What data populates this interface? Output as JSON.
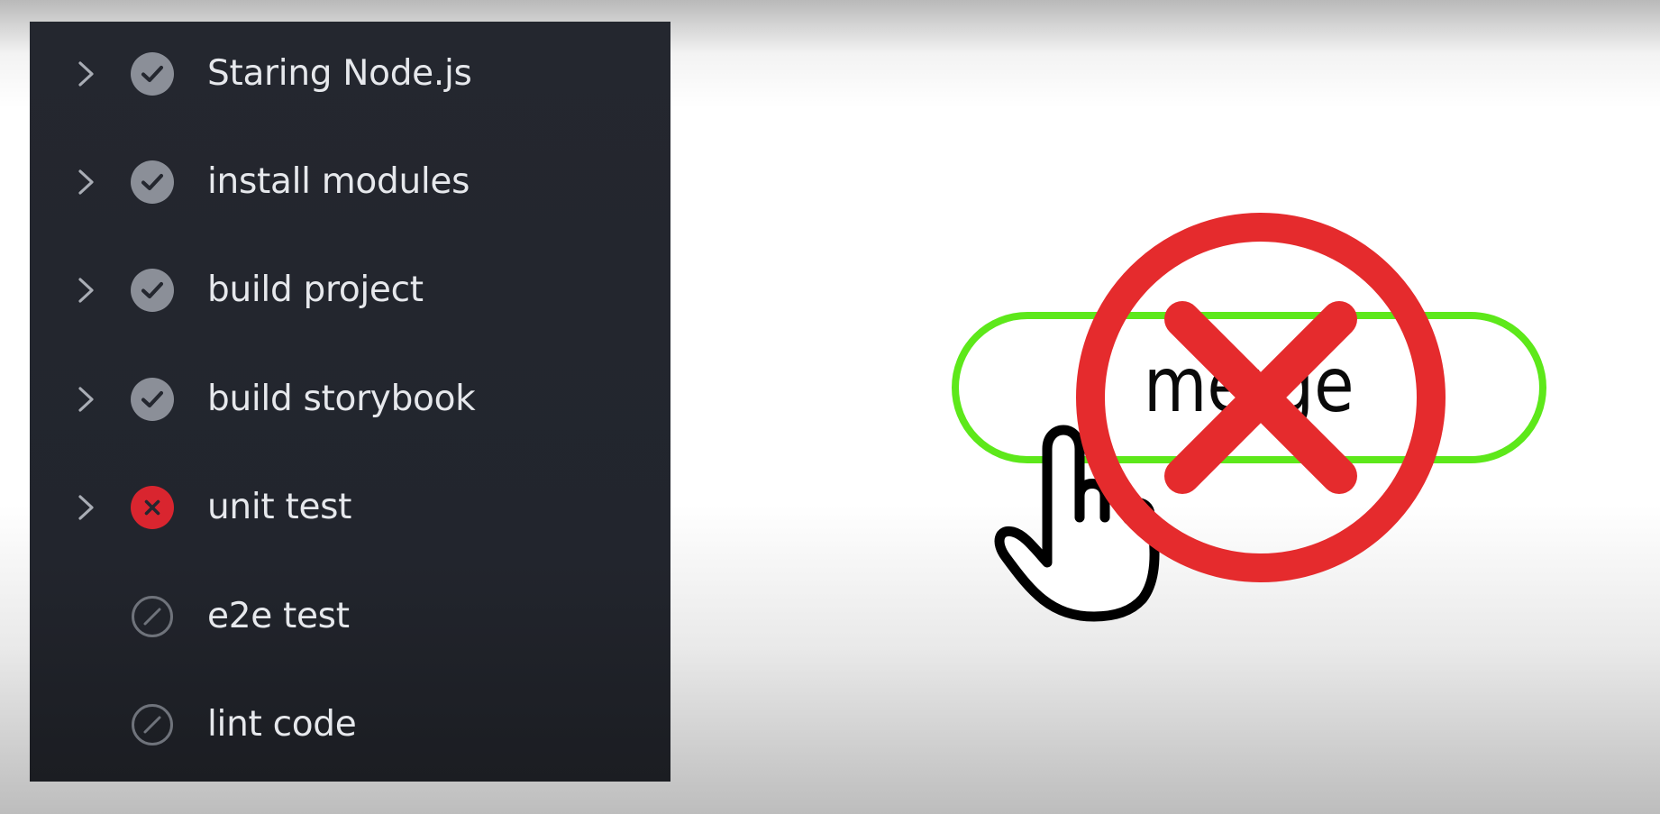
{
  "pipeline": {
    "steps": [
      {
        "label": "Staring Node.js",
        "status": "success",
        "expandable": true
      },
      {
        "label": "install modules",
        "status": "success",
        "expandable": true
      },
      {
        "label": "build project",
        "status": "success",
        "expandable": true
      },
      {
        "label": "build storybook",
        "status": "success",
        "expandable": true
      },
      {
        "label": "unit test",
        "status": "failed",
        "expandable": true
      },
      {
        "label": "e2e test",
        "status": "skipped",
        "expandable": false
      },
      {
        "label": "lint code",
        "status": "skipped",
        "expandable": false
      }
    ]
  },
  "merge": {
    "button_label": "merge",
    "blocked": true
  },
  "colors": {
    "panel_background": "#24272f",
    "step_text": "#e6e8ec",
    "success_icon": "#8b8f98",
    "failed_icon": "#d9252f",
    "skipped_icon": "#6f737b",
    "merge_border": "#5de81a",
    "blocked_sign": "#e52b2d"
  },
  "icons": {
    "chevron": "chevron-right-icon",
    "success": "check-circle-icon",
    "failed": "x-circle-icon",
    "skipped": "skip-circle-icon",
    "cursor": "hand-pointer-icon",
    "blocked": "prohibited-icon"
  }
}
